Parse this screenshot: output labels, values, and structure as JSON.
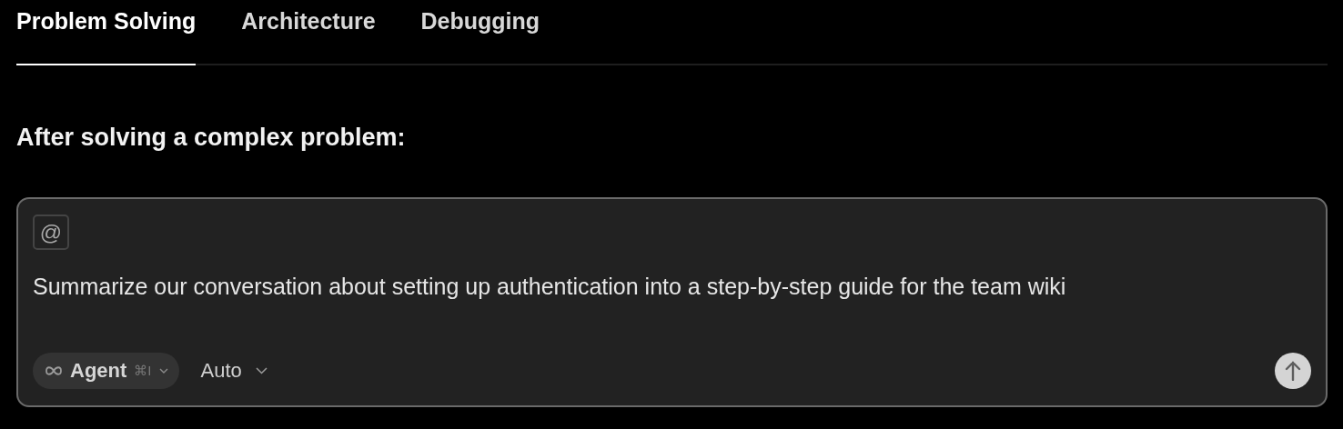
{
  "tabs": [
    {
      "label": "Problem Solving",
      "selected": true
    },
    {
      "label": "Architecture",
      "selected": false
    },
    {
      "label": "Debugging",
      "selected": false
    }
  ],
  "heading": "After solving a complex problem:",
  "composer": {
    "mention_button": "@",
    "prompt": "Summarize our conversation about setting up authentication into a step-by-step guide for the team wiki",
    "mode": {
      "label": "Agent",
      "shortcut": "⌘I"
    },
    "model": {
      "label": "Auto"
    }
  }
}
